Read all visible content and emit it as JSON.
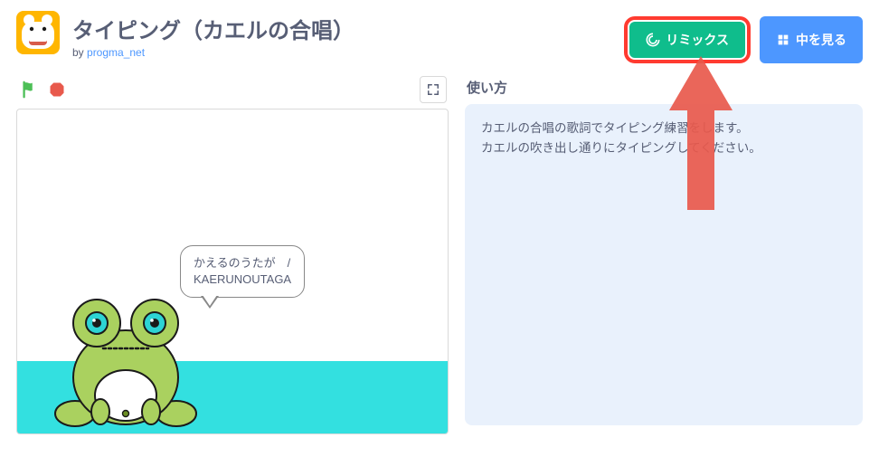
{
  "header": {
    "title": "タイピング（カエルの合唱）",
    "by_prefix": "by ",
    "author": "progma_net",
    "remix_label": "リミックス",
    "see_inside_label": "中を見る"
  },
  "stage": {
    "speech_line1": "かえるのうたが　/",
    "speech_line2": "KAERUNOUTAGA"
  },
  "info": {
    "heading": "使い方",
    "line1": "カエルの合唱の歌詞でタイピング練習をします。",
    "line2": "カエルの吹き出し通りにタイピングしてください。"
  }
}
